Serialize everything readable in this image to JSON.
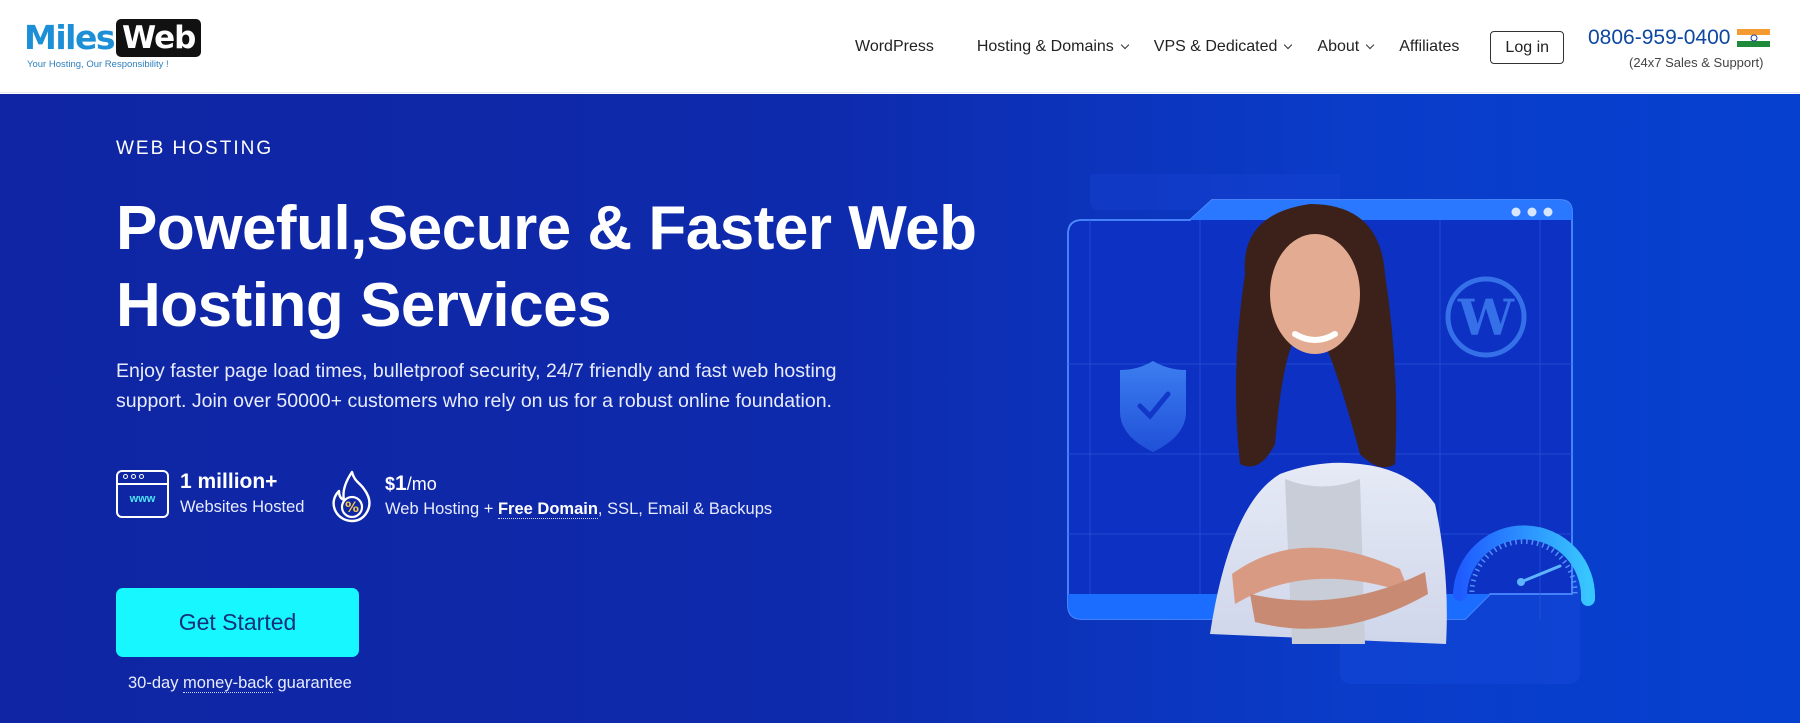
{
  "header": {
    "logo": {
      "text_primary": "Miles",
      "text_secondary": "Web",
      "tagline": "Your Hosting, Our Responsibility !"
    },
    "nav": [
      {
        "label": "WordPress",
        "has_dropdown": false
      },
      {
        "label": "Hosting & Domains",
        "has_dropdown": true
      },
      {
        "label": "VPS & Dedicated",
        "has_dropdown": true
      },
      {
        "label": "About",
        "has_dropdown": true
      },
      {
        "label": "Affiliates",
        "has_dropdown": false
      }
    ],
    "login_label": "Log in",
    "phone": "0806-959-0400",
    "phone_country_flag": "india-flag-icon",
    "support_note": "(24x7 Sales & Support)"
  },
  "hero": {
    "eyebrow": "WEB HOSTING",
    "title": "Poweful,Secure & Faster Web Hosting Services",
    "description": "Enjoy faster page load times, bulletproof security, 24/7 friendly and fast web hosting support. Join over 50000+ customers who rely on us for a robust online foundation.",
    "stats": [
      {
        "icon": "browser-www-icon",
        "icon_text": "www",
        "headline": "1 million+",
        "subtext": "Websites Hosted"
      },
      {
        "icon": "fire-percent-icon",
        "icon_text": "%",
        "price_currency": "$",
        "price_value": "1",
        "price_period": "/mo",
        "subtext_before": "Web Hosting + ",
        "subtext_link": "Free Domain",
        "subtext_after": ", SSL, Email & Backups"
      }
    ],
    "cta_label": "Get Started",
    "guarantee_before": "30-day ",
    "guarantee_link": "money-back",
    "guarantee_after": " guarantee"
  },
  "colors": {
    "hero_bg": "#0f25a3",
    "cta_bg": "#16f7ff",
    "cta_text": "#14307a",
    "phone": "#0d47a1",
    "logo_blue": "#1c8fd6"
  }
}
